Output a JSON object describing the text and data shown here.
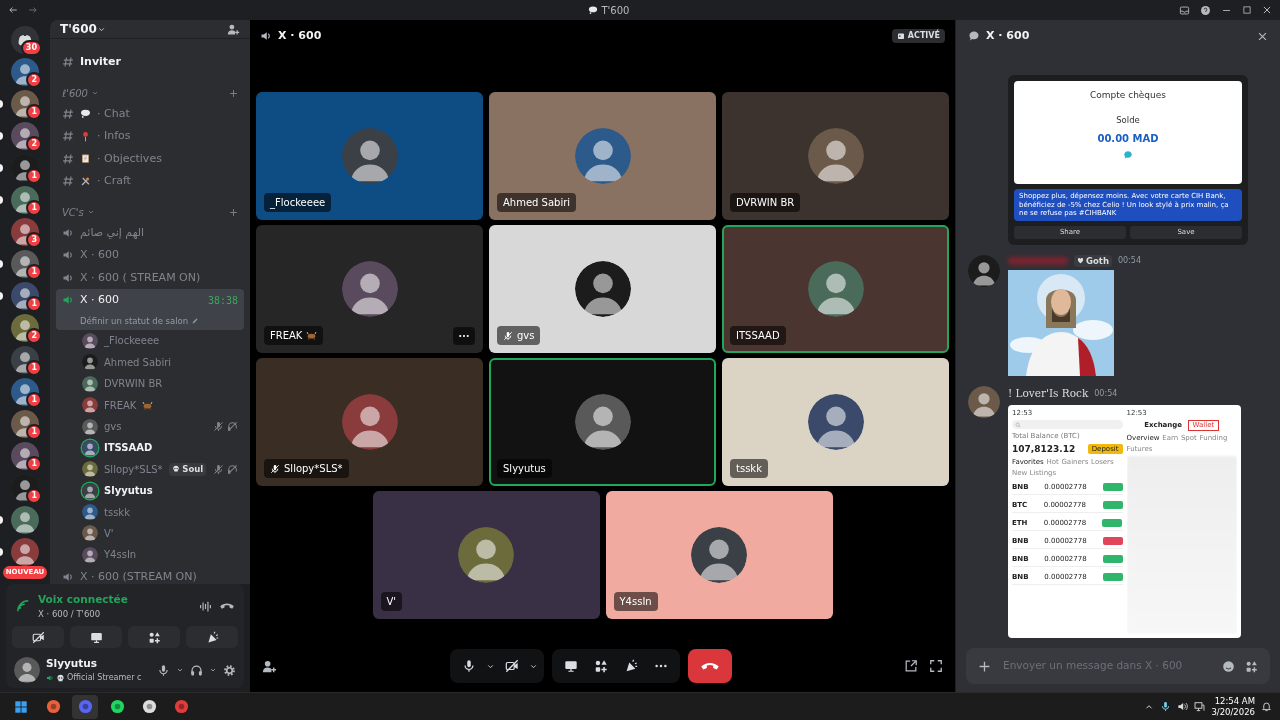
{
  "titlebar": {
    "title": "T'600"
  },
  "servers": [
    {
      "kind": "home",
      "badge": "30",
      "unread": false
    },
    {
      "kind": "server",
      "badge": "2",
      "unread": false
    },
    {
      "kind": "server",
      "badge": "1",
      "unread": true
    },
    {
      "kind": "server",
      "badge": "2",
      "unread": true
    },
    {
      "kind": "server",
      "badge": "1",
      "unread": true
    },
    {
      "kind": "server",
      "badge": "1",
      "unread": true
    },
    {
      "kind": "server",
      "badge": "3",
      "unread": false
    },
    {
      "kind": "server",
      "badge": "1",
      "unread": true
    },
    {
      "kind": "server",
      "badge": "1",
      "unread": true
    },
    {
      "kind": "server",
      "badge": "2",
      "unread": false
    },
    {
      "kind": "server",
      "badge": "1",
      "unread": false
    },
    {
      "kind": "server",
      "badge": "1",
      "unread": false
    },
    {
      "kind": "server",
      "badge": "1",
      "unread": false
    },
    {
      "kind": "server",
      "badge": "1",
      "unread": false
    },
    {
      "kind": "server",
      "badge": "1",
      "unread": false
    },
    {
      "kind": "server",
      "unread": true
    },
    {
      "kind": "server",
      "label": "NOUVEAU",
      "unread": true
    }
  ],
  "server_header": {
    "name": "T'600"
  },
  "channels": [
    {
      "kind": "text",
      "name": "Inviter",
      "unread": true
    },
    {
      "kind": "category",
      "name": "ℓ'600"
    },
    {
      "kind": "text",
      "name": "· Chat",
      "unread": false
    },
    {
      "kind": "text",
      "name": "· Infos",
      "unread": false
    },
    {
      "kind": "text",
      "name": "· Objectives",
      "unread": false
    },
    {
      "kind": "text",
      "name": "· Craft",
      "unread": false
    },
    {
      "kind": "category",
      "name": "VC's"
    },
    {
      "kind": "voice",
      "name": "الهم إني صائم",
      "selected": false
    },
    {
      "kind": "voice",
      "name": "X · 600",
      "selected": false
    },
    {
      "kind": "voice",
      "name": "X · 600 ( STREAM ON)",
      "selected": false
    },
    {
      "kind": "voice",
      "name": "X · 600",
      "selected": true,
      "timer": "38:38",
      "status_hint": "Définir un statut de salon",
      "members": [
        {
          "name": "_Flockeeee",
          "speaking": false,
          "muted": false
        },
        {
          "name": "Ahmed Sabiri",
          "speaking": false,
          "muted": false
        },
        {
          "name": "DVRWIN BR",
          "speaking": false,
          "muted": false
        },
        {
          "name": "FREAK",
          "speaking": false,
          "muted": false
        },
        {
          "name": "gvs",
          "speaking": false,
          "muted": true
        },
        {
          "name": "ITSSAAD",
          "speaking": true,
          "muted": false
        },
        {
          "name": "Sllopy*SLS*",
          "tag": "Soul",
          "speaking": false,
          "muted": true
        },
        {
          "name": "Slyyutus",
          "speaking": true,
          "muted": false
        },
        {
          "name": "tsskk",
          "speaking": false,
          "muted": false
        },
        {
          "name": "V'",
          "speaking": false,
          "muted": false
        },
        {
          "name": "Y4ssIn",
          "speaking": false,
          "muted": false
        }
      ]
    },
    {
      "kind": "voice",
      "name": "X · 600 (STREAM ON)",
      "selected": false
    }
  ],
  "voice_panel": {
    "status": "Voix connectée",
    "location": "X · 600 / T'600"
  },
  "user": {
    "name": "Slyyutus",
    "status": "Official Streamer c"
  },
  "call": {
    "title": "X · 600",
    "badge": "ACTIVÉ"
  },
  "tiles": [
    {
      "name": "_Flockeeee",
      "color": "#0e4d84",
      "speaking": false,
      "muted": false,
      "hovered": false
    },
    {
      "name": "Ahmed Sabiri",
      "color": "#8a7262",
      "speaking": false,
      "muted": false,
      "hovered": false
    },
    {
      "name": "DVRWIN BR",
      "color": "#3c322e",
      "speaking": false,
      "muted": false,
      "hovered": false
    },
    {
      "name": "FREAK",
      "color": "#262626",
      "speaking": false,
      "muted": false,
      "hovered": true
    },
    {
      "name": "gvs",
      "color": "#d8d8d8",
      "speaking": false,
      "muted": true,
      "hovered": false
    },
    {
      "name": "ITSSAAD",
      "color": "#4a3530",
      "speaking": true,
      "muted": false,
      "hovered": false
    },
    {
      "name": "Sllopy*SLS*",
      "color": "#3a2d24",
      "speaking": false,
      "muted": true,
      "hovered": false
    },
    {
      "name": "Slyyutus",
      "color": "#121212",
      "speaking": true,
      "muted": false,
      "hovered": false
    },
    {
      "name": "tsskk",
      "color": "#dbd3c4",
      "speaking": false,
      "muted": false,
      "hovered": false
    },
    {
      "name": "V'",
      "color": "#3a3046",
      "speaking": false,
      "muted": false,
      "hovered": false
    },
    {
      "name": "Y4ssIn",
      "color": "#f1aaa0",
      "speaking": false,
      "muted": false,
      "hovered": false
    }
  ],
  "chat": {
    "title": "X · 600",
    "placeholder": "Envoyer un message dans X · 600",
    "messages": [
      {
        "kind": "bank",
        "account": "Compte chèques",
        "balance_label": "Solde",
        "balance": "00.00 MAD",
        "promo": "Shoppez plus, dépensez moins. Avec votre carte CIH Bank, bénéficiez de -5% chez Celio ! Un look stylé à prix malin, ça ne se refuse pas #CIHBANK",
        "buttons": [
          "Share",
          "Save"
        ]
      },
      {
        "tag": "Goth",
        "time": "00:54"
      },
      {
        "kind": "exchange",
        "author": "! Lover'Is Rock",
        "time": "00:54",
        "left_time": "12:53",
        "right_time": "12:53",
        "balance_label": "Total Balance (BTC)",
        "balance": "107,8123.12",
        "deposit": "Deposit",
        "tabs": [
          "Favorites",
          "Hot",
          "Gainers",
          "Losers",
          "New Listings"
        ],
        "rows": [
          {
            "coin": "BNB",
            "price": "0.00002778",
            "color": "#31b56a"
          },
          {
            "coin": "BTC",
            "price": "0.00002778",
            "color": "#31b56a"
          },
          {
            "coin": "ETH",
            "price": "0.00002778",
            "color": "#31b56a"
          },
          {
            "coin": "BNB",
            "price": "0.00002778",
            "color": "#e0455a"
          },
          {
            "coin": "BNB",
            "price": "0.00002778",
            "color": "#31b56a"
          },
          {
            "coin": "BNB",
            "price": "0.00002778",
            "color": "#31b56a"
          }
        ],
        "right_tabs": [
          "Exchange",
          "Wallet"
        ],
        "right_subtabs": [
          "Overview",
          "Earn",
          "Spot",
          "Funding",
          "Futures"
        ]
      }
    ]
  },
  "taskbar": {
    "time": "12:54 AM",
    "date": "3/20/2026"
  }
}
